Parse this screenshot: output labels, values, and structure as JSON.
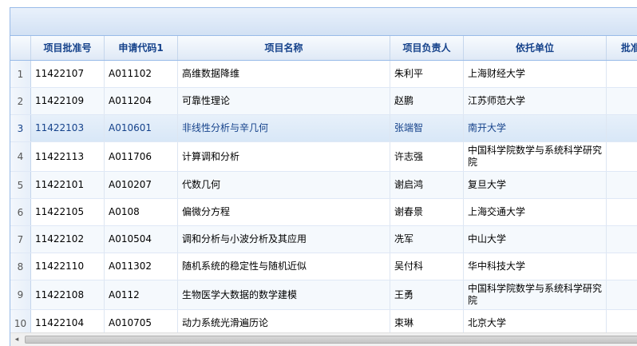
{
  "columns": [
    "",
    "项目批准号",
    "申请代码1",
    "项目名称",
    "项目负责人",
    "依托单位",
    "批准"
  ],
  "rows": [
    {
      "num": "1",
      "id": "11422107",
      "code": "A011102",
      "name": "高维数据降维",
      "leader": "朱利平",
      "unit": "上海财经大学"
    },
    {
      "num": "2",
      "id": "11422109",
      "code": "A011204",
      "name": "可靠性理论",
      "leader": "赵鹏",
      "unit": "江苏师范大学"
    },
    {
      "num": "3",
      "id": "11422103",
      "code": "A010601",
      "name": "非线性分析与辛几何",
      "leader": "张端智",
      "unit": "南开大学"
    },
    {
      "num": "4",
      "id": "11422113",
      "code": "A011706",
      "name": "计算调和分析",
      "leader": "许志强",
      "unit": "中国科学院数学与系统科学研究院"
    },
    {
      "num": "5",
      "id": "11422101",
      "code": "A010207",
      "name": "代数几何",
      "leader": "谢启鸿",
      "unit": "复旦大学"
    },
    {
      "num": "6",
      "id": "11422105",
      "code": "A0108",
      "name": "偏微分方程",
      "leader": "谢春景",
      "unit": "上海交通大学"
    },
    {
      "num": "7",
      "id": "11422102",
      "code": "A010504",
      "name": "调和分析与小波分析及其应用",
      "leader": "冼军",
      "unit": "中山大学"
    },
    {
      "num": "8",
      "id": "11422110",
      "code": "A011302",
      "name": "随机系统的稳定性与随机近似",
      "leader": "吴付科",
      "unit": "华中科技大学"
    },
    {
      "num": "9",
      "id": "11422108",
      "code": "A0112",
      "name": "生物医学大数据的数学建模",
      "leader": "王勇",
      "unit": "中国科学院数学与系统科学研究院"
    },
    {
      "num": "10",
      "id": "11422104",
      "code": "A010705",
      "name": "动力系统光滑遍历论",
      "leader": "束琳",
      "unit": "北京大学"
    }
  ],
  "selected_row": "3",
  "scrollbar": {
    "left_arrow": "◂"
  }
}
